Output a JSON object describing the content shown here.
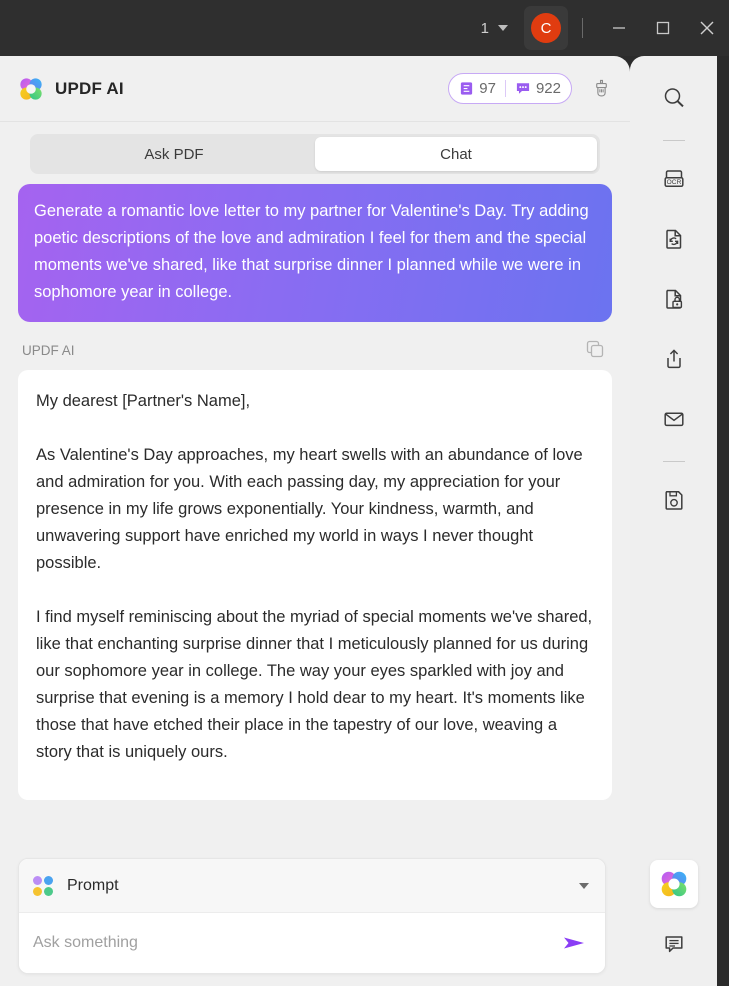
{
  "titlebar": {
    "page_number": "1",
    "page_dropdown_icon": "chevron-down-icon",
    "avatar_initial": "C",
    "minimize_icon": "minimize-icon",
    "maximize_icon": "maximize-icon",
    "close_icon": "close-icon"
  },
  "header": {
    "logo_icon": "updf-flower-logo-icon",
    "brand": "UPDF AI",
    "document_icon": "document-icon",
    "document_credits": "97",
    "chat_icon": "chat-bubble-icon",
    "chat_credits": "922",
    "clear_icon": "brush-icon"
  },
  "tabs": [
    {
      "label": "Ask PDF",
      "active": false
    },
    {
      "label": "Chat",
      "active": true
    }
  ],
  "conversation": {
    "user_message": "Generate a romantic love letter to my partner for Valentine's Day. Try adding poetic descriptions of the love and admiration I feel for them and the special moments we've shared, like that surprise dinner I planned while we were in sophomore year in college.",
    "ai_label": "UPDF AI",
    "copy_icon": "copy-icon",
    "ai_paragraphs": [
      "My dearest [Partner's Name],",
      "As Valentine's Day approaches, my heart swells with an abundance of love and admiration for you. With each passing day, my appreciation for your presence in my life grows exponentially. Your kindness, warmth, and unwavering support have enriched my world in ways I never thought possible.",
      "I find myself reminiscing about the myriad of special moments we've shared, like that enchanting surprise dinner that I meticulously planned for us during our sophomore year in college. The way your eyes sparkled with joy and surprise that evening is a memory I hold dear to my heart. It's moments like those that have etched their place in the tapestry of our love, weaving a story that is uniquely ours."
    ]
  },
  "composer": {
    "mode_icon": "four-dots-icon",
    "mode_label": "Prompt",
    "mode_caret_icon": "chevron-down-icon",
    "input_value": "",
    "input_placeholder": "Ask something",
    "send_icon": "send-arrow-icon"
  },
  "sidebar": {
    "items": [
      {
        "name": "search-icon",
        "label": "Search"
      },
      {
        "name": "ocr-icon",
        "label": "OCR"
      },
      {
        "name": "convert-icon",
        "label": "Convert"
      },
      {
        "name": "protect-icon",
        "label": "Protect"
      },
      {
        "name": "share-icon",
        "label": "Share"
      },
      {
        "name": "email-icon",
        "label": "Email"
      },
      {
        "name": "save-icon",
        "label": "Save"
      },
      {
        "name": "updf-ai-icon",
        "label": "UPDF AI"
      },
      {
        "name": "comment-icon",
        "label": "Comment"
      }
    ]
  },
  "colors": {
    "accent_purple": "#8a5cf0",
    "gradient_start": "#a563f0",
    "gradient_end": "#6b73f0",
    "avatar_red": "#e03c10",
    "titlebar_dark": "#2f2f2f",
    "panel_gray": "#f0f0f0"
  }
}
